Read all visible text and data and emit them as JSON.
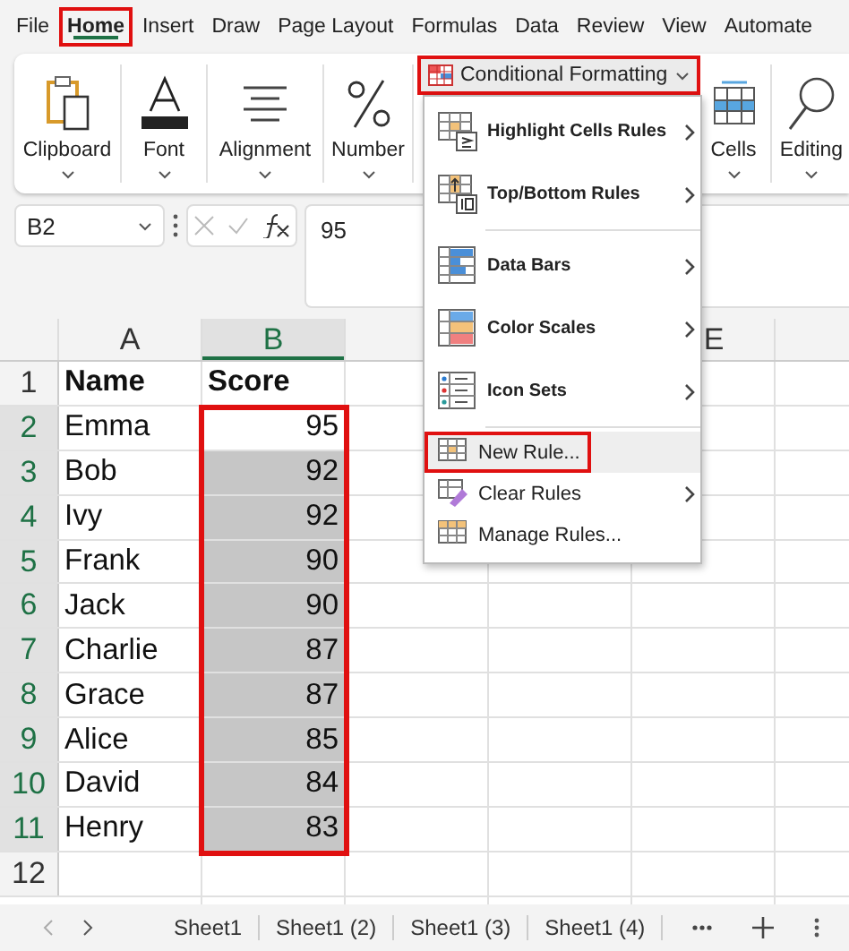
{
  "menu_tabs": [
    {
      "label": "File",
      "selected": false,
      "highlighted": false
    },
    {
      "label": "Home",
      "selected": true,
      "highlighted": true
    },
    {
      "label": "Insert",
      "selected": false,
      "highlighted": false
    },
    {
      "label": "Draw",
      "selected": false,
      "highlighted": false
    },
    {
      "label": "Page Layout",
      "selected": false,
      "highlighted": false
    },
    {
      "label": "Formulas",
      "selected": false,
      "highlighted": false
    },
    {
      "label": "Data",
      "selected": false,
      "highlighted": false
    },
    {
      "label": "Review",
      "selected": false,
      "highlighted": false
    },
    {
      "label": "View",
      "selected": false,
      "highlighted": false
    },
    {
      "label": "Automate",
      "selected": false,
      "highlighted": false
    }
  ],
  "ribbon_groups": [
    {
      "label": "Clipboard",
      "kind": "clipboard"
    },
    {
      "label": "Font",
      "kind": "font"
    },
    {
      "label": "Alignment",
      "kind": "alignment"
    },
    {
      "label": "Number",
      "kind": "number"
    },
    {
      "label": "Conditional Formatting",
      "kind": "conditional",
      "highlighted": true
    },
    {
      "label": "Cells",
      "kind": "cells"
    },
    {
      "label": "Editing",
      "kind": "editing"
    }
  ],
  "formula_bar": {
    "name_box": "B2",
    "formula": "95"
  },
  "columns": [
    {
      "label": "A",
      "kind": "letter",
      "selected": false
    },
    {
      "label": "B",
      "kind": "letter",
      "selected": true
    },
    {
      "kind": "blank"
    },
    {
      "kind": "covered"
    },
    {
      "label": "E",
      "kind": "letter",
      "selected": false
    },
    {
      "kind": "blank"
    }
  ],
  "selection_outlined": true,
  "rows": [
    {
      "number": "1",
      "kind": "header",
      "selected": false,
      "active": false,
      "cells": [
        "Name",
        "Score"
      ]
    },
    {
      "number": "2",
      "kind": "data",
      "selected": true,
      "active": true,
      "cells": [
        "Emma",
        "95"
      ]
    },
    {
      "number": "3",
      "kind": "data",
      "selected": true,
      "active": false,
      "cells": [
        "Bob",
        "92"
      ]
    },
    {
      "number": "4",
      "kind": "data",
      "selected": true,
      "active": false,
      "cells": [
        "Ivy",
        "92"
      ]
    },
    {
      "number": "5",
      "kind": "data",
      "selected": true,
      "active": false,
      "cells": [
        "Frank",
        "90"
      ]
    },
    {
      "number": "6",
      "kind": "data",
      "selected": true,
      "active": false,
      "cells": [
        "Jack",
        "90"
      ]
    },
    {
      "number": "7",
      "kind": "data",
      "selected": true,
      "active": false,
      "cells": [
        "Charlie",
        "87"
      ]
    },
    {
      "number": "8",
      "kind": "data",
      "selected": true,
      "active": false,
      "cells": [
        "Grace",
        "87"
      ]
    },
    {
      "number": "9",
      "kind": "data",
      "selected": true,
      "active": false,
      "cells": [
        "Alice",
        "85"
      ]
    },
    {
      "number": "10",
      "kind": "data",
      "selected": true,
      "active": false,
      "cells": [
        "David",
        "84"
      ]
    },
    {
      "number": "11",
      "kind": "data",
      "selected": true,
      "active": false,
      "cells": [
        "Henry",
        "83"
      ]
    },
    {
      "number": "12",
      "kind": "empty",
      "selected": false
    }
  ],
  "conditional_formatting_menu": [
    {
      "label": "Highlight Cells Rules",
      "kind": "highlight",
      "submenu": true,
      "selected": false,
      "highlighted": false
    },
    {
      "label": "Top/Bottom Rules",
      "kind": "topbottom",
      "submenu": true,
      "selected": false,
      "highlighted": false
    },
    {
      "label": "Data Bars",
      "kind": "databars",
      "submenu": true,
      "selected": false,
      "highlighted": false
    },
    {
      "label": "Color Scales",
      "kind": "colorscales",
      "submenu": true,
      "selected": false,
      "highlighted": false
    },
    {
      "label": "Icon Sets",
      "kind": "iconsets",
      "submenu": true,
      "selected": false,
      "highlighted": false
    },
    {
      "label": "New Rule...",
      "kind": "newrule",
      "submenu": false,
      "selected": true,
      "highlighted": true
    },
    {
      "label": "Clear Rules",
      "kind": "clearrules",
      "submenu": true,
      "selected": false,
      "highlighted": false
    },
    {
      "label": "Manage Rules...",
      "kind": "managerules",
      "submenu": false,
      "selected": false,
      "highlighted": false
    }
  ],
  "sheet_tabs": [
    {
      "label": "Sheet1"
    },
    {
      "label": "Sheet1 (2)"
    },
    {
      "label": "Sheet1 (3)"
    },
    {
      "label": "Sheet1 (4)"
    }
  ]
}
